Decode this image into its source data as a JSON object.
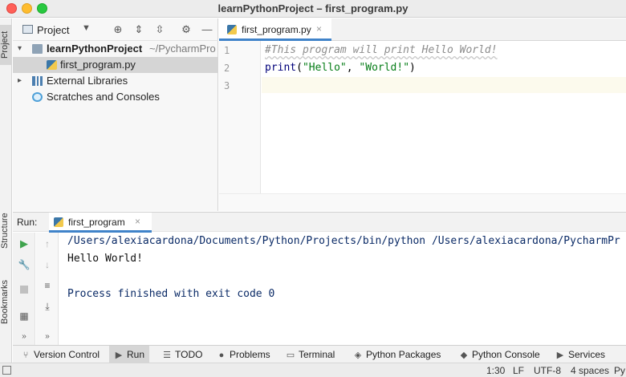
{
  "window": {
    "title": "learnPythonProject – first_program.py"
  },
  "tool_strip": {
    "project": "Project",
    "structure": "Structure",
    "bookmarks": "Bookmarks"
  },
  "project_panel": {
    "header_label": "Project",
    "tree": [
      {
        "label": "learnPythonProject",
        "path": "~/PycharmPro"
      },
      {
        "label": "first_program.py"
      },
      {
        "label": "External Libraries"
      },
      {
        "label": "Scratches and Consoles"
      }
    ]
  },
  "editor": {
    "tab": {
      "label": "first_program.py",
      "close": "×"
    },
    "line_numbers": [
      "1",
      "2",
      "3"
    ],
    "code": {
      "line1": "#This program will print Hello World!",
      "line2_fn": "print",
      "line2_open": "(",
      "line2_str1": "\"Hello\"",
      "line2_sep": ", ",
      "line2_str2": "\"World!\"",
      "line2_close": ")"
    }
  },
  "run": {
    "label": "Run:",
    "tab": {
      "label": "first_program",
      "close": "×"
    },
    "console": [
      "/Users/alexiacardona/Documents/Python/Projects/bin/python /Users/alexiacardona/PycharmPr",
      "Hello World!",
      "",
      "Process finished with exit code 0"
    ]
  },
  "bottom_tools": [
    {
      "label": "Version Control"
    },
    {
      "label": "Run"
    },
    {
      "label": "TODO"
    },
    {
      "label": "Problems"
    },
    {
      "label": "Terminal"
    },
    {
      "label": "Python Packages"
    },
    {
      "label": "Python Console"
    },
    {
      "label": "Services"
    }
  ],
  "status": {
    "position": "1:30",
    "line_sep": "LF",
    "encoding": "UTF-8",
    "indent": "4 spaces",
    "interpreter": "Py"
  },
  "colors": {
    "accent": "#4083c9",
    "run_green": "#3fa34d",
    "string": "#067d17",
    "comment": "#8c8c8c"
  }
}
